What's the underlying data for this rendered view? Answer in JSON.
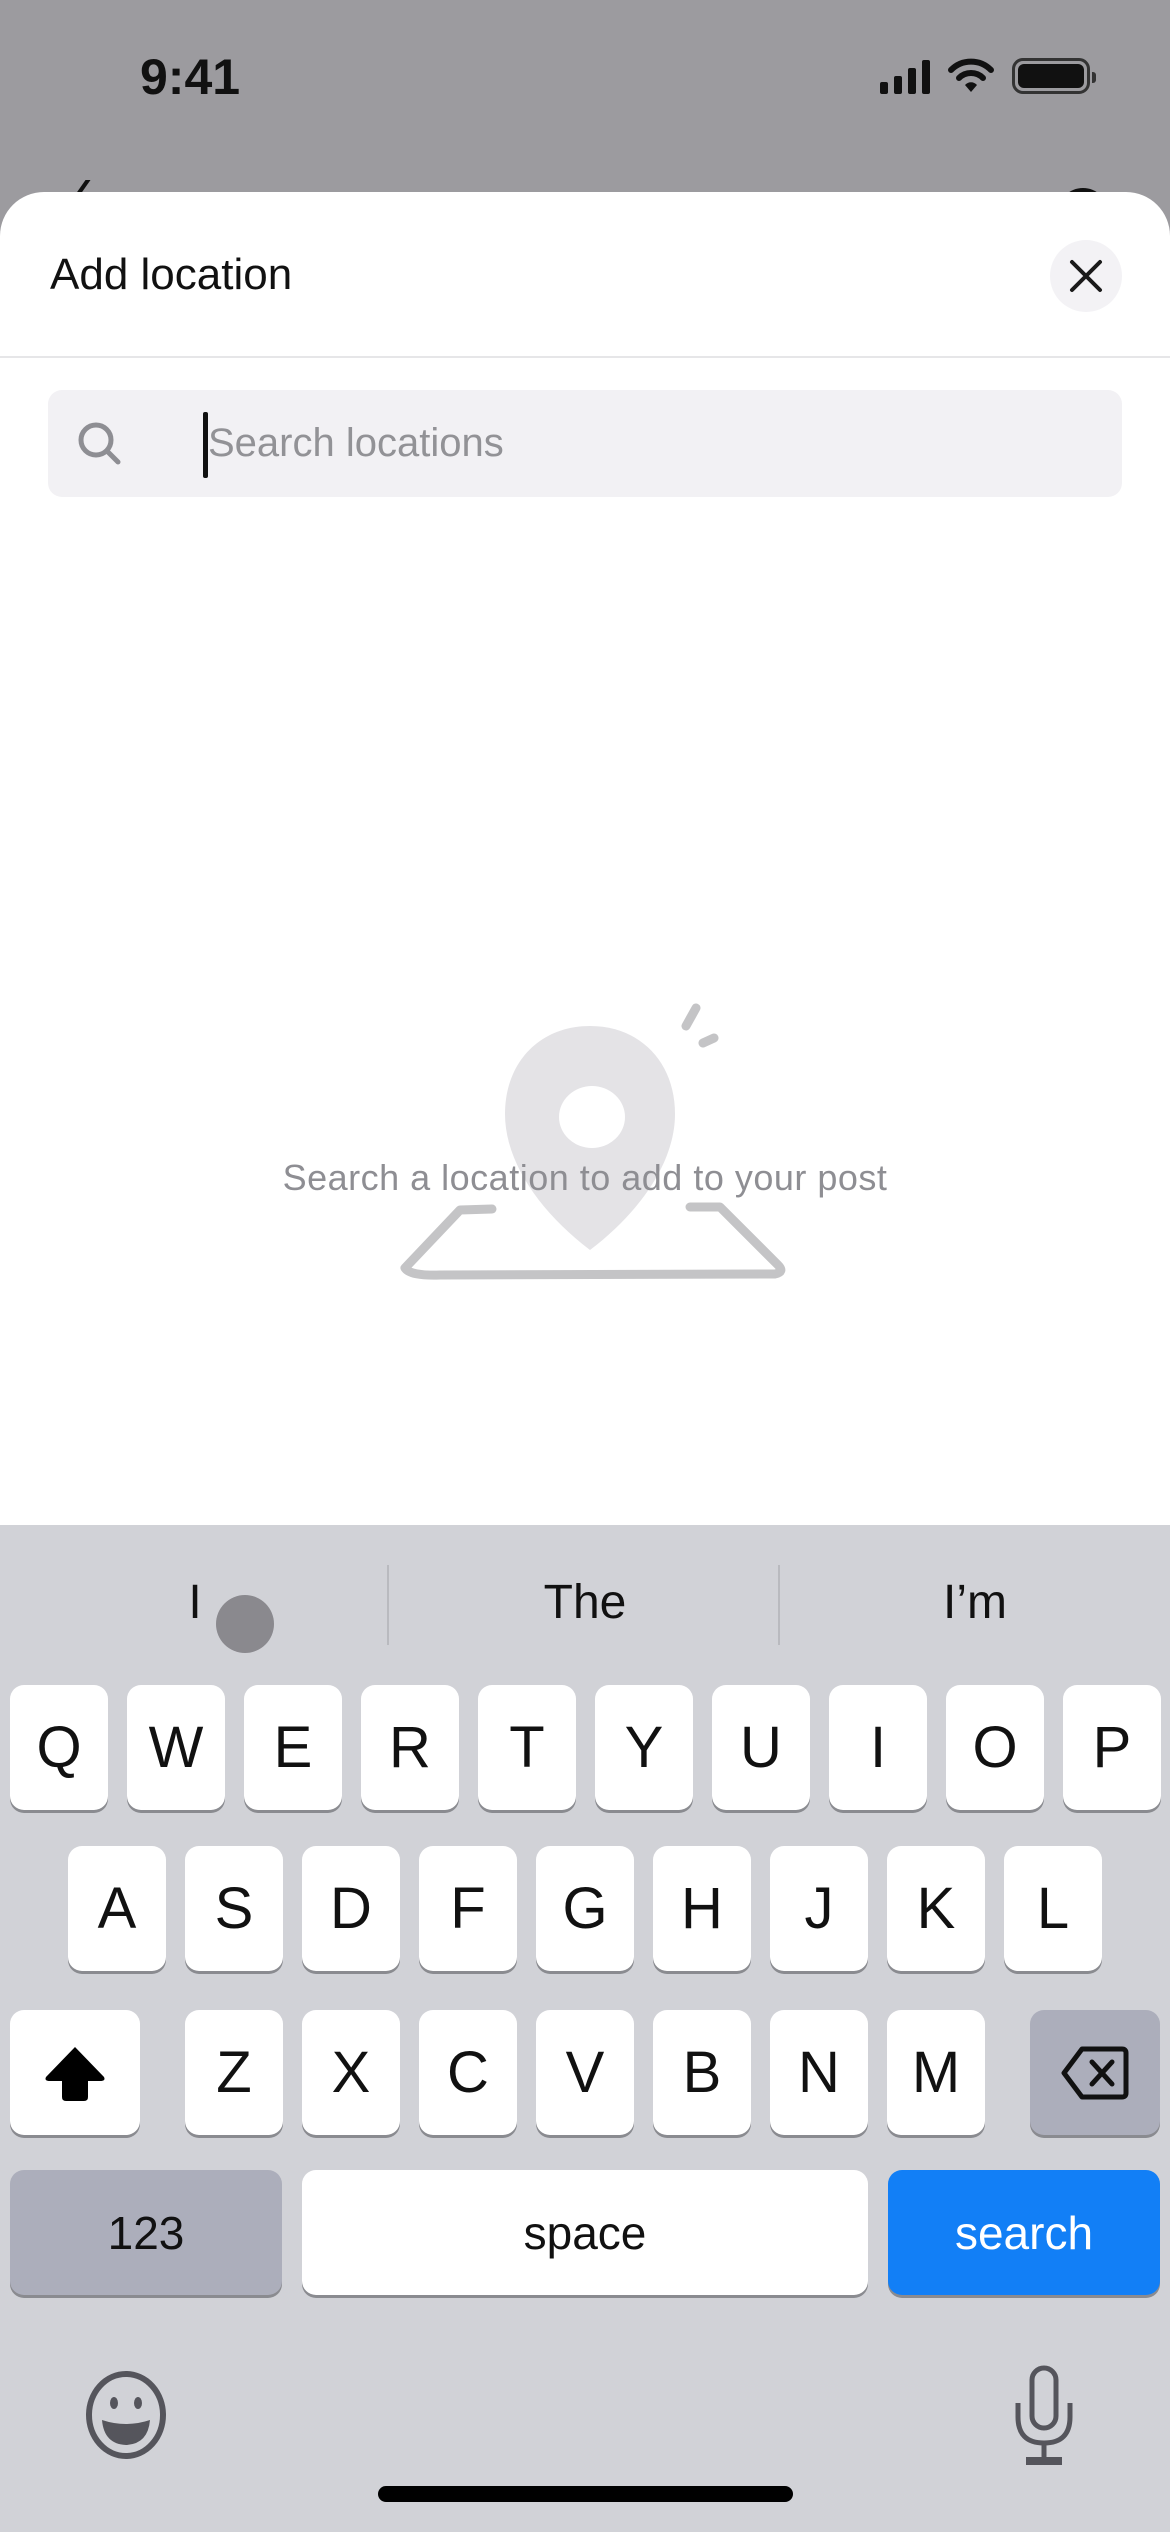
{
  "status_bar": {
    "time": "9:41",
    "icons": [
      "cellular-signal-icon",
      "wifi-icon",
      "battery-icon"
    ]
  },
  "sheet": {
    "title": "Add location",
    "close_icon": "close-icon",
    "search": {
      "value": "",
      "placeholder": "Search locations",
      "icon": "search-icon"
    },
    "empty_state": {
      "illustration": "map-pin-illustration",
      "message": "Search a location to add to your post"
    }
  },
  "keyboard": {
    "suggestions": [
      "I",
      "The",
      "I’m"
    ],
    "rows": [
      [
        "Q",
        "W",
        "E",
        "R",
        "T",
        "Y",
        "U",
        "I",
        "O",
        "P"
      ],
      [
        "A",
        "S",
        "D",
        "F",
        "G",
        "H",
        "J",
        "K",
        "L"
      ],
      [
        "Z",
        "X",
        "C",
        "V",
        "B",
        "N",
        "M"
      ]
    ],
    "shift_icon": "shift-icon",
    "backspace_icon": "backspace-icon",
    "numbers_label": "123",
    "space_label": "space",
    "return_label": "search",
    "emoji_icon": "emoji-icon",
    "mic_icon": "microphone-icon",
    "accent_color": "#127ff6"
  }
}
